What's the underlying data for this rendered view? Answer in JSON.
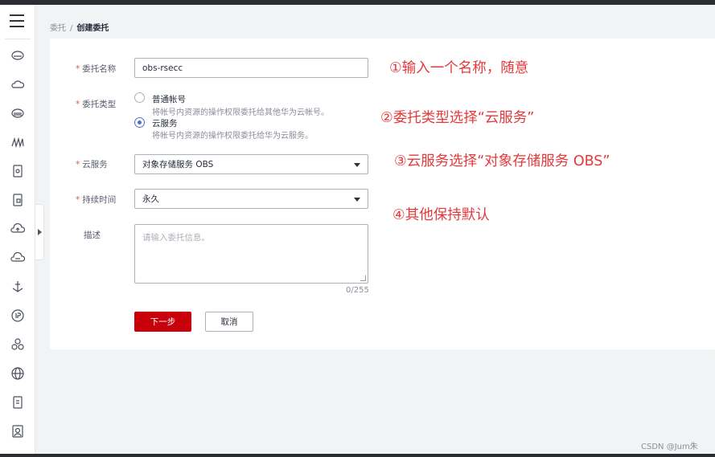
{
  "breadcrumb": {
    "parent": "委托",
    "separator": "/",
    "current": "创建委托"
  },
  "form": {
    "name_label": "委托名称",
    "name_value": "obs-rsecc",
    "type_label": "委托类型",
    "type_options": [
      {
        "label": "普通帐号",
        "desc": "将帐号内资源的操作权限委托给其他华为云帐号。",
        "checked": false
      },
      {
        "label": "云服务",
        "desc": "将帐号内资源的操作权限委托给华为云服务。",
        "checked": true
      }
    ],
    "service_label": "云服务",
    "service_value": "对象存储服务 OBS",
    "duration_label": "持续时间",
    "duration_value": "永久",
    "desc_label": "描述",
    "desc_placeholder": "请输入委托信息。",
    "desc_counter": "0/255",
    "required_mark": "*"
  },
  "buttons": {
    "next": "下一步",
    "cancel": "取消"
  },
  "notes": [
    "①输入一个名称，随意",
    "②委托类型选择“云服务”",
    "③云服务选择“对象存储服务 OBS”",
    "④其他保持默认"
  ],
  "watermark": "CSDN @Jum朱",
  "colors": {
    "primary": "#c7000b",
    "note": "#e4393c",
    "radio": "#526ecc"
  },
  "sidebar_icons": [
    "console-icon",
    "cloud-icon",
    "database-icon",
    "monitor-icon",
    "storage-icon",
    "document-icon",
    "cloud-upload-icon",
    "cloud-sync-icon",
    "anchor-icon",
    "ip-icon",
    "cluster-icon",
    "globe-icon",
    "file-icon",
    "report-icon"
  ]
}
